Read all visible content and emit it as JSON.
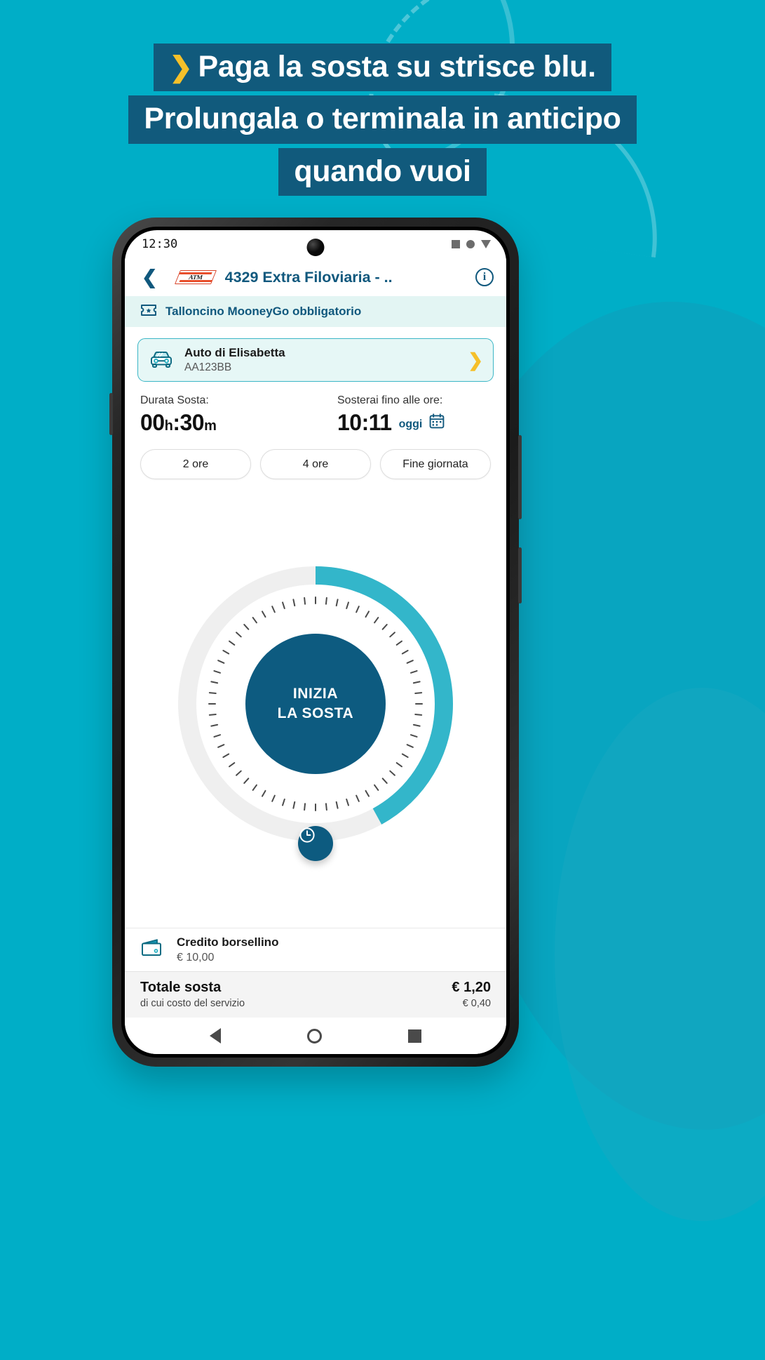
{
  "theme": {
    "bg": "#00aec7",
    "headline_box": "#115a7c",
    "accent_yellow": "#f5c02a",
    "brand_blue": "#10587d",
    "brand_teal": "#3cb6c6",
    "dial_dark": "#0d5b80"
  },
  "headline": {
    "chevron": "❯",
    "line1": "Paga la sosta su strisce blu.",
    "line2": "Prolungala o terminala in anticipo",
    "line3": "quando vuoi"
  },
  "phone": {
    "statusbar": {
      "time": "12:30",
      "icons": [
        "square-icon",
        "circle-icon",
        "triangle-down-icon"
      ]
    },
    "navbar": {
      "back_icon": "chevron-left-icon",
      "logo_text": "ATM",
      "title": "4329 Extra Filoviaria - ..",
      "info_label": "i"
    },
    "banner": {
      "icon": "ticket-icon",
      "text": "Talloncino MooneyGo obbligatorio"
    },
    "vehicle": {
      "icon": "car-icon",
      "name": "Auto di Elisabetta",
      "plate": "AA123BB",
      "chevron": "❯"
    },
    "duration": {
      "left_label": "Durata Sosta:",
      "left_value_hours": "00",
      "left_unit_h": "h",
      "left_sep": ":",
      "left_value_minutes": "30",
      "left_unit_m": "m",
      "right_label": "Sosterai fino alle ore:",
      "right_value": "10:11",
      "right_day": "oggi",
      "calendar_icon": "calendar-icon"
    },
    "quick_pills": [
      {
        "label": "2 ore"
      },
      {
        "label": "4 ore"
      },
      {
        "label": "Fine giornata"
      }
    ],
    "dial": {
      "progress_percent": 42,
      "button_line1": "INIZIA",
      "button_line2": "LA SOSTA",
      "handle_icon": "clock-icon",
      "track_color": "#efefef",
      "progress_color": "#33b6ca"
    },
    "wallet": {
      "icon": "wallet-icon",
      "title": "Credito borsellino",
      "amount": "€ 10,00"
    },
    "total": {
      "title": "Totale sosta",
      "subtitle": "di cui costo del servizio",
      "amount": "€ 1,20",
      "sub_amount": "€ 0,40"
    },
    "androidnav": {
      "back": "nav-back-icon",
      "home": "nav-home-icon",
      "recent": "nav-recent-icon"
    }
  }
}
